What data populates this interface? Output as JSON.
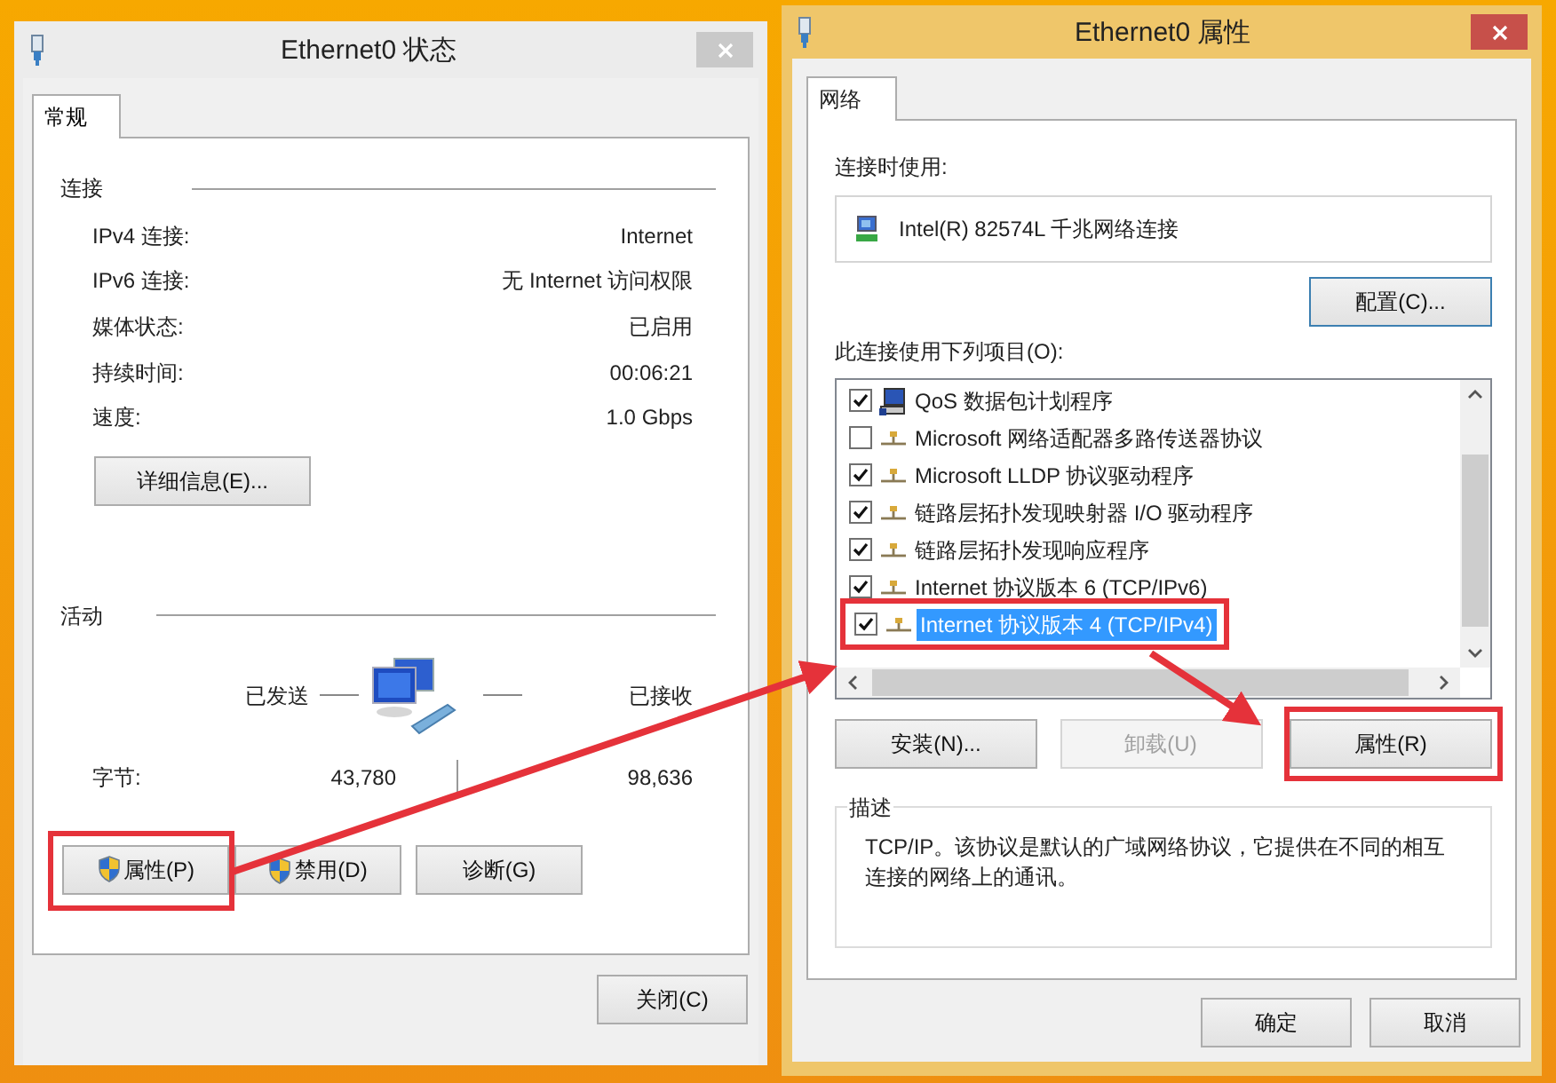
{
  "status_window": {
    "title": "Ethernet0 状态",
    "active": false,
    "tabs": [
      {
        "label": "常规",
        "selected": true
      }
    ],
    "connection": {
      "heading": "连接",
      "rows": [
        {
          "label": "IPv4 连接:",
          "value": "Internet"
        },
        {
          "label": "IPv6 连接:",
          "value": "无 Internet 访问权限"
        },
        {
          "label": "媒体状态:",
          "value": "已启用"
        },
        {
          "label": "持续时间:",
          "value": "00:06:21"
        },
        {
          "label": "速度:",
          "value": "1.0 Gbps"
        }
      ]
    },
    "details_button": "详细信息(E)...",
    "activity": {
      "heading": "活动",
      "sent_label": "已发送",
      "received_label": "已接收",
      "bytes_label": "字节:",
      "bytes_sent": "43,780",
      "bytes_received": "98,636"
    },
    "buttons": [
      {
        "label": "属性(P)",
        "shield": true,
        "highlighted": true
      },
      {
        "label": "禁用(D)",
        "shield": true,
        "highlighted": false
      },
      {
        "label": "诊断(G)",
        "shield": false,
        "highlighted": false
      }
    ],
    "close_button": "关闭(C)"
  },
  "properties_window": {
    "title": "Ethernet0 属性",
    "active": true,
    "tabs": [
      {
        "label": "网络",
        "selected": true
      }
    ],
    "connect_using_label": "连接时使用:",
    "adapter": "Intel(R) 82574L 千兆网络连接",
    "configure_button": {
      "label": "配置(C)...",
      "focused": true
    },
    "items_label": "此连接使用下列项目(O):",
    "items": [
      {
        "kind": "scheduler",
        "label": "QoS 数据包计划程序",
        "checked": true,
        "selected": false,
        "highlighted": false
      },
      {
        "kind": "protocol",
        "label": "Microsoft 网络适配器多路传送器协议",
        "checked": false,
        "selected": false,
        "highlighted": false
      },
      {
        "kind": "protocol",
        "label": "Microsoft LLDP 协议驱动程序",
        "checked": true,
        "selected": false,
        "highlighted": false
      },
      {
        "kind": "protocol",
        "label": "链路层拓扑发现映射器 I/O 驱动程序",
        "checked": true,
        "selected": false,
        "highlighted": false
      },
      {
        "kind": "protocol",
        "label": "链路层拓扑发现响应程序",
        "checked": true,
        "selected": false,
        "highlighted": false
      },
      {
        "kind": "protocol",
        "label": "Internet 协议版本 6 (TCP/IPv6)",
        "checked": true,
        "selected": false,
        "highlighted": false
      },
      {
        "kind": "protocol",
        "label": "Internet 协议版本 4 (TCP/IPv4)",
        "checked": true,
        "selected": true,
        "highlighted": true
      }
    ],
    "item_buttons": [
      {
        "label": "安装(N)...",
        "disabled": false,
        "highlighted": false
      },
      {
        "label": "卸载(U)",
        "disabled": true,
        "highlighted": false
      },
      {
        "label": "属性(R)",
        "disabled": false,
        "highlighted": true
      }
    ],
    "description": {
      "heading": "描述",
      "text": "TCP/IP。该协议是默认的广域网络协议，它提供在不同的相互连接的网络上的通讯。"
    },
    "dialog_buttons": [
      "确定",
      "取消"
    ]
  }
}
